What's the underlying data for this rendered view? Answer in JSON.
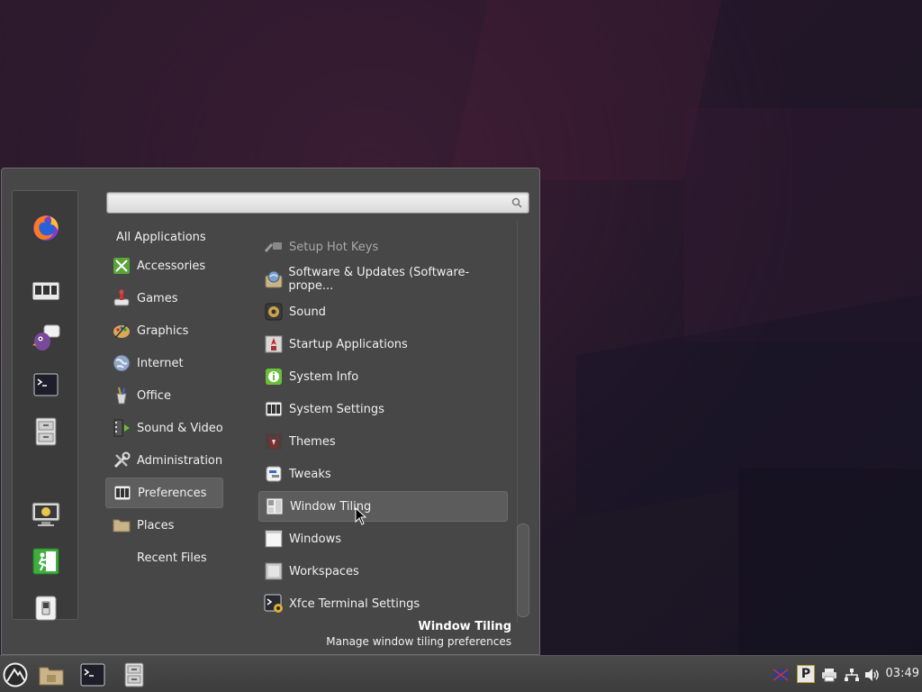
{
  "favorites": [
    {
      "name": "Firefox",
      "icon": "firefox-icon"
    },
    {
      "name": "Software Manager",
      "icon": "software-manager-icon"
    },
    {
      "name": "Pidgin",
      "icon": "pidgin-icon"
    },
    {
      "name": "Terminal",
      "icon": "terminal-icon"
    },
    {
      "name": "Files",
      "icon": "file-cabinet-icon"
    },
    {
      "name": "Lock Screen",
      "icon": "lock-screen-icon"
    },
    {
      "name": "Logout",
      "icon": "logout-icon"
    },
    {
      "name": "Shut Down",
      "icon": "power-switch-icon"
    }
  ],
  "search": {
    "placeholder": "",
    "value": ""
  },
  "categories": [
    {
      "label": "All Applications"
    },
    {
      "label": "Accessories",
      "icon": "accessories-icon"
    },
    {
      "label": "Games",
      "icon": "games-icon"
    },
    {
      "label": "Graphics",
      "icon": "graphics-icon"
    },
    {
      "label": "Internet",
      "icon": "internet-globe-icon"
    },
    {
      "label": "Office",
      "icon": "office-icon"
    },
    {
      "label": "Sound & Video",
      "icon": "sound-video-icon"
    },
    {
      "label": "Administration",
      "icon": "administration-tools-icon"
    },
    {
      "label": "Preferences",
      "icon": "preferences-icon",
      "selected": true
    },
    {
      "label": "Places",
      "icon": "folder-icon"
    },
    {
      "label": "Recent Files"
    }
  ],
  "apps": [
    {
      "label": "Setup Hot Keys",
      "icon": "hotkeys-icon",
      "dimmed": true
    },
    {
      "label": "Software & Updates (Software-prope...",
      "icon": "software-updates-icon"
    },
    {
      "label": "Sound",
      "icon": "sound-speaker-icon"
    },
    {
      "label": "Startup Applications",
      "icon": "startup-applications-icon"
    },
    {
      "label": "System Info",
      "icon": "system-info-icon"
    },
    {
      "label": "System Settings",
      "icon": "system-settings-icon"
    },
    {
      "label": "Themes",
      "icon": "themes-icon"
    },
    {
      "label": "Tweaks",
      "icon": "tweaks-icon"
    },
    {
      "label": "Window Tiling",
      "icon": "window-tiling-icon",
      "selected": true
    },
    {
      "label": "Windows",
      "icon": "windows-icon"
    },
    {
      "label": "Workspaces",
      "icon": "workspaces-icon"
    },
    {
      "label": "Xfce Terminal Settings",
      "icon": "terminal-settings-icon"
    }
  ],
  "description": {
    "title": "Window Tiling",
    "text": "Manage window tiling preferences"
  },
  "taskbar": {
    "clock": "03:49",
    "tray_indicator_letter": "P"
  },
  "colors": {
    "menu_bg": "#474747",
    "selection_bg": "#5c5c5c",
    "accent_green": "#6abf3a"
  }
}
